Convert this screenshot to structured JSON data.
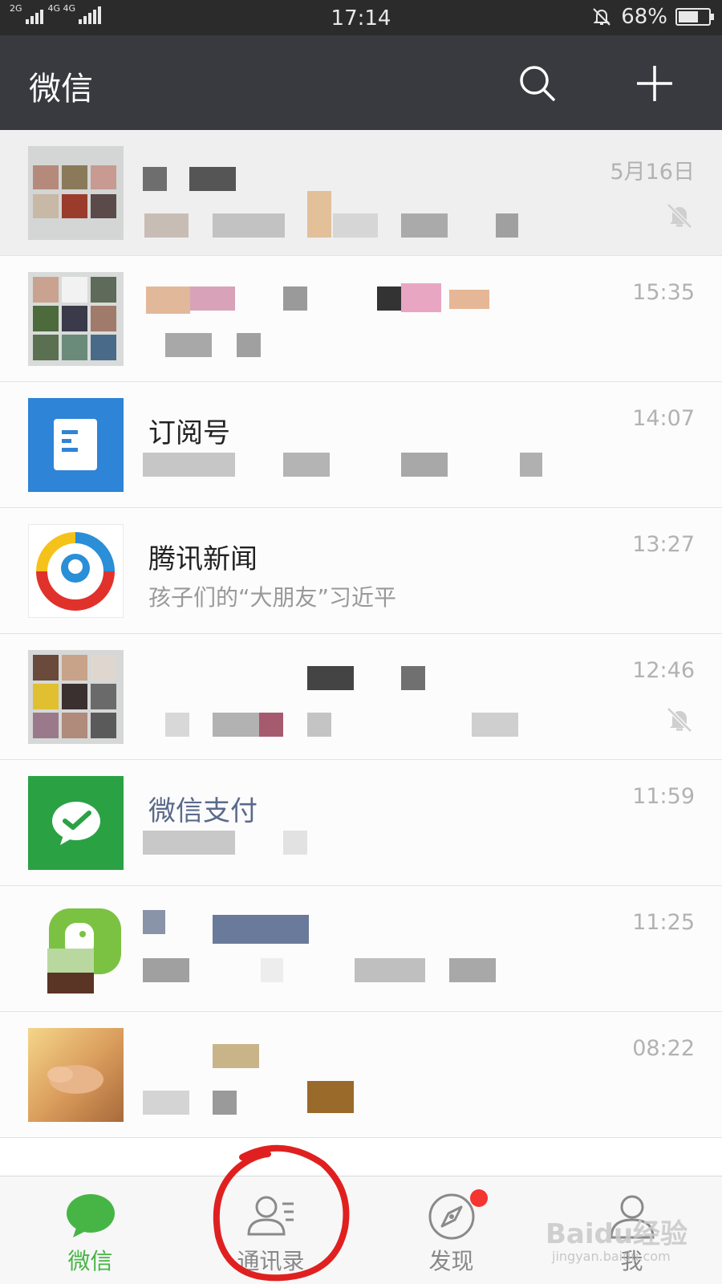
{
  "status_bar": {
    "signal_1_label": "2G",
    "signal_2_label": "4G 4G",
    "time": "17:14",
    "battery_percent": "68%",
    "battery_level": 0.68
  },
  "header": {
    "title": "微信",
    "search_icon": "search-icon",
    "add_icon": "plus-icon"
  },
  "chats": [
    {
      "name": "",
      "preview": "",
      "time": "5月16日",
      "muted": true,
      "pinned": true
    },
    {
      "name": "",
      "preview": "",
      "time": "15:35",
      "muted": false
    },
    {
      "name": "订阅号",
      "preview": "",
      "time": "14:07",
      "muted": false
    },
    {
      "name": "腾讯新闻",
      "preview": "孩子们的“大朋友”习近平",
      "time": "13:27",
      "muted": false
    },
    {
      "name": "",
      "preview": "",
      "time": "12:46",
      "muted": true
    },
    {
      "name": "微信支付",
      "preview": "",
      "time": "11:59",
      "muted": false
    },
    {
      "name": "",
      "preview": "",
      "time": "11:25",
      "muted": false
    },
    {
      "name": "",
      "preview": "",
      "time": "08:22",
      "muted": false
    }
  ],
  "nav": {
    "items": [
      {
        "label": "微信",
        "icon": "chat-bubble-icon",
        "active": true
      },
      {
        "label": "通讯录",
        "icon": "contacts-icon",
        "active": false
      },
      {
        "label": "发现",
        "icon": "compass-icon",
        "active": false,
        "badge": true
      },
      {
        "label": "我",
        "icon": "person-icon",
        "active": false
      }
    ]
  },
  "colors": {
    "header_bg": "#393a3f",
    "status_bg": "#2b2b2b",
    "accent_green": "#46b545",
    "badge_red": "#f43530",
    "annotation_red": "#e02020"
  },
  "watermark": {
    "text": "Baidu经验",
    "sub": "jingyan.baidu.com"
  }
}
